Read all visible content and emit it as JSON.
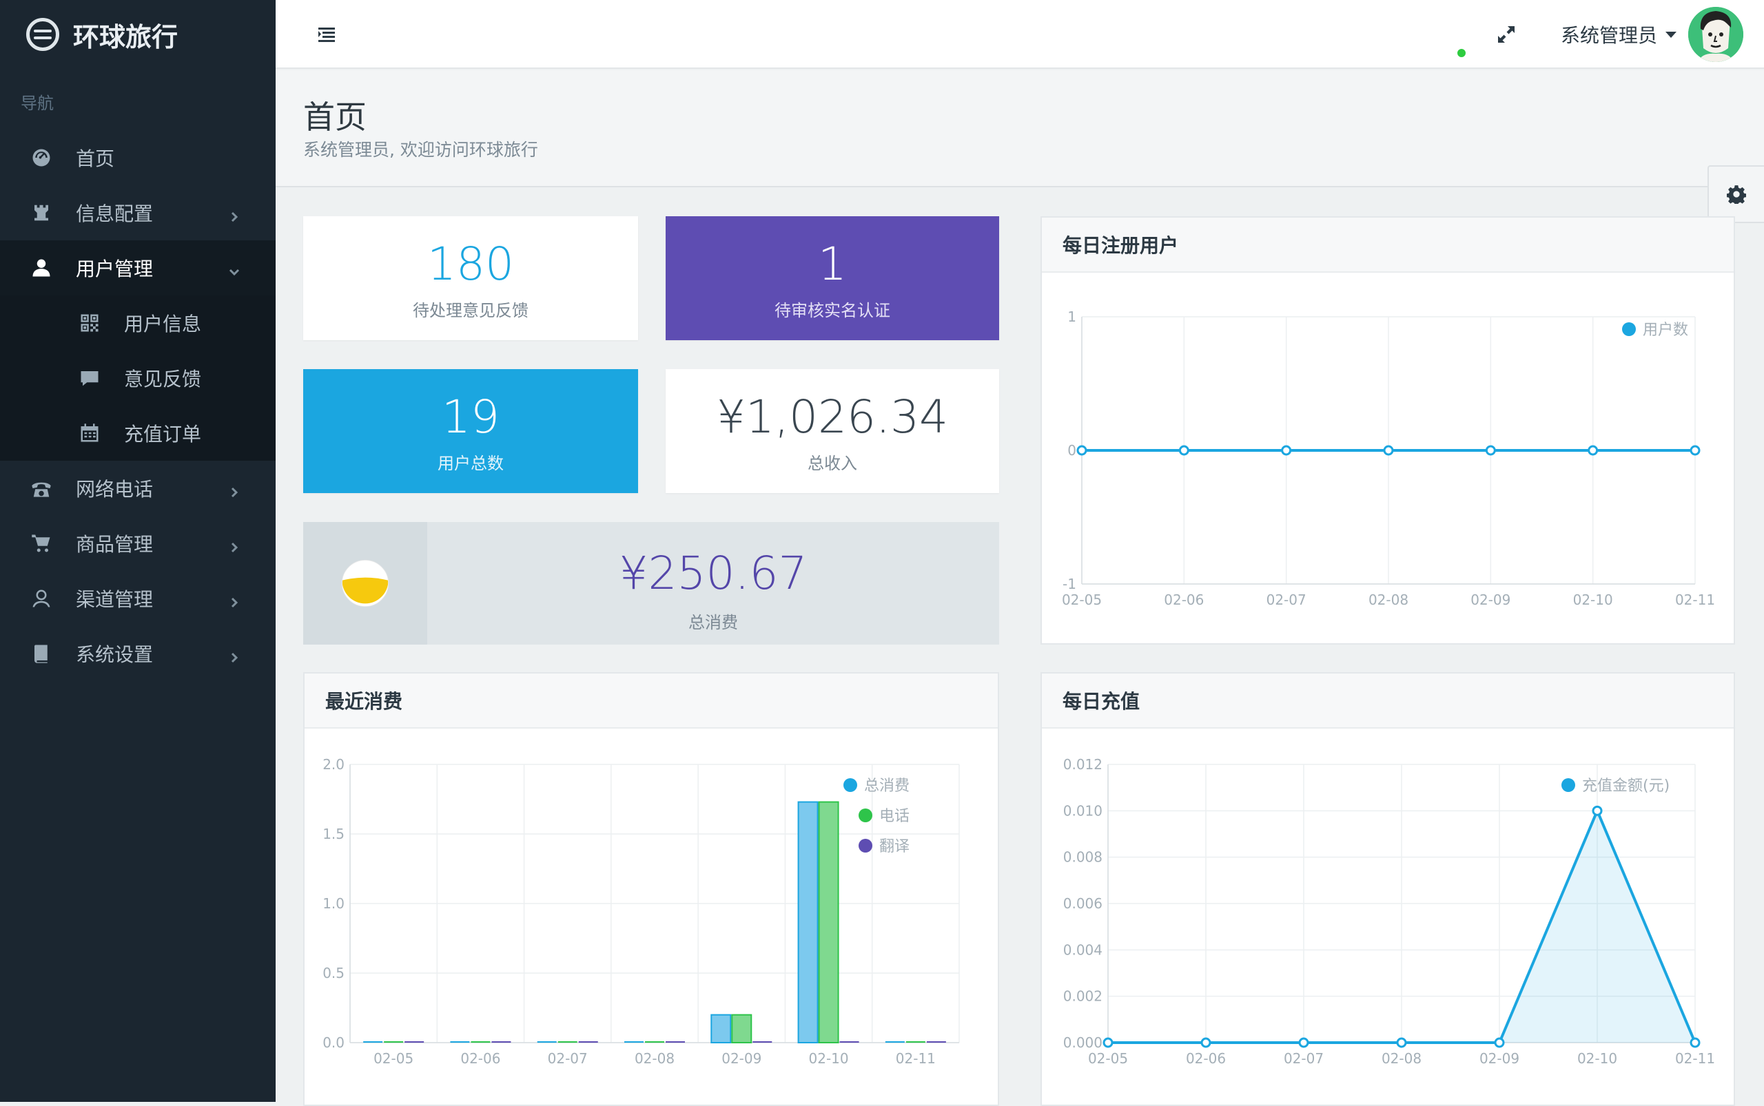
{
  "brand": {
    "name": "环球旅行"
  },
  "sidebar": {
    "caption": "导航",
    "items": [
      {
        "label": "首页",
        "icon": "dashboard-icon"
      },
      {
        "label": "信息配置",
        "icon": "rook-icon"
      },
      {
        "label": "用户管理",
        "icon": "user-icon"
      },
      {
        "label": "网络电话",
        "icon": "phone-icon"
      },
      {
        "label": "商品管理",
        "icon": "cart-icon"
      },
      {
        "label": "渠道管理",
        "icon": "contact-icon"
      },
      {
        "label": "系统设置",
        "icon": "book-icon"
      }
    ],
    "submenu": [
      {
        "label": "用户信息",
        "icon": "qrcode-icon"
      },
      {
        "label": "意见反馈",
        "icon": "comment-icon"
      },
      {
        "label": "充值订单",
        "icon": "calendar-icon"
      }
    ]
  },
  "header": {
    "user": "系统管理员"
  },
  "page": {
    "title": "首页",
    "subtitle": "系统管理员, 欢迎访问环球旅行"
  },
  "stats": {
    "feedback": {
      "value": "180",
      "label": "待处理意见反馈"
    },
    "verify": {
      "value": "1",
      "label": "待审核实名认证"
    },
    "users": {
      "value": "19",
      "label": "用户总数"
    },
    "income": {
      "value": "¥1,026.34",
      "label": "总收入"
    },
    "consume": {
      "value": "¥250.67",
      "label": "总消费"
    }
  },
  "colors": {
    "blue": "#1ba6e0",
    "purple": "#5e4db2",
    "green": "#2ec44a",
    "sidebar": "#1b2630"
  },
  "panels": {
    "daily_users": "每日注册用户",
    "recent_consume": "最近消费",
    "daily_recharge": "每日充值"
  },
  "chart_data": [
    {
      "type": "line",
      "title": "每日注册用户",
      "x": [
        "02-05",
        "02-06",
        "02-07",
        "02-08",
        "02-09",
        "02-10",
        "02-11"
      ],
      "series": [
        {
          "name": "用户数",
          "values": [
            0,
            0,
            0,
            0,
            0,
            0,
            0
          ]
        }
      ],
      "ylim": [
        -1,
        1
      ],
      "yticks": [
        "1",
        "0",
        "-1"
      ],
      "legend": "top-right",
      "grid": true
    },
    {
      "type": "bar",
      "title": "最近消费",
      "categories": [
        "02-05",
        "02-06",
        "02-07",
        "02-08",
        "02-09",
        "02-10",
        "02-11"
      ],
      "series": [
        {
          "name": "总消费",
          "values": [
            0,
            0,
            0,
            0,
            0.2,
            1.73,
            0
          ]
        },
        {
          "name": "电话",
          "values": [
            0,
            0,
            0,
            0,
            0.2,
            1.73,
            0
          ]
        },
        {
          "name": "翻译",
          "values": [
            0,
            0,
            0,
            0,
            0,
            0,
            0
          ]
        }
      ],
      "ylim": [
        0,
        2.0
      ],
      "yticks": [
        "2.0",
        "1.5",
        "1.0",
        "0.5",
        "0.0"
      ],
      "legend": "top-right",
      "grid": true
    },
    {
      "type": "area",
      "title": "每日充值",
      "x": [
        "02-05",
        "02-06",
        "02-07",
        "02-08",
        "02-09",
        "02-10",
        "02-11"
      ],
      "series": [
        {
          "name": "充值金额(元)",
          "values": [
            0,
            0,
            0,
            0,
            0,
            0.01,
            0
          ]
        }
      ],
      "ylim": [
        0,
        0.012
      ],
      "yticks": [
        "0.012",
        "0.010",
        "0.008",
        "0.006",
        "0.004",
        "0.002",
        "0.000"
      ],
      "legend": "top-right",
      "grid": true
    }
  ]
}
